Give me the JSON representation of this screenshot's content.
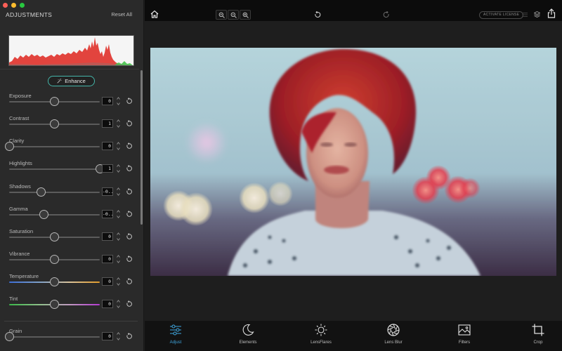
{
  "panel": {
    "title": "ADJUSTMENTS",
    "reset_all": "Reset All",
    "enhance_label": "Enhance"
  },
  "sliders": [
    {
      "id": "exposure",
      "label": "Exposure",
      "value": "0",
      "level": 0.5,
      "track": "plain"
    },
    {
      "id": "contrast",
      "label": "Contrast",
      "value": "1",
      "level": 0.5,
      "track": "plain"
    },
    {
      "id": "clarity",
      "label": "Clarity",
      "value": "0",
      "level": 0.0,
      "track": "plain"
    },
    {
      "id": "highlights",
      "label": "Highlights",
      "value": "1",
      "level": 1.0,
      "track": "plain"
    },
    {
      "id": "shadows",
      "label": "Shadows",
      "value": "-0...",
      "level": 0.35,
      "track": "plain"
    },
    {
      "id": "gamma",
      "label": "Gamma",
      "value": "-0...",
      "level": 0.38,
      "track": "plain"
    },
    {
      "id": "saturation",
      "label": "Saturation",
      "value": "0",
      "level": 0.5,
      "track": "plain"
    },
    {
      "id": "vibrance",
      "label": "Vibrance",
      "value": "0",
      "level": 0.5,
      "track": "plain"
    },
    {
      "id": "temperature",
      "label": "Temperature",
      "value": "0",
      "level": 0.5,
      "track": "temperature"
    },
    {
      "id": "tint",
      "label": "Tint",
      "value": "0",
      "level": 0.5,
      "track": "tint"
    },
    {
      "id": "grain",
      "label": "Grain",
      "value": "0",
      "level": 0.0,
      "track": "plain"
    }
  ],
  "topbar": {
    "activate_license": "ACTIVATE LICENSE"
  },
  "tools": [
    {
      "id": "adjust",
      "label": "Adjust",
      "icon": "sliders-icon",
      "active": true
    },
    {
      "id": "elements",
      "label": "Elements",
      "icon": "moon-icon",
      "active": false
    },
    {
      "id": "lensflares",
      "label": "LensFlares",
      "icon": "sun-icon",
      "active": false
    },
    {
      "id": "lensblur",
      "label": "Lens Blur",
      "icon": "aperture-icon",
      "active": false
    },
    {
      "id": "filters",
      "label": "Filters",
      "icon": "landscape-icon",
      "active": false
    },
    {
      "id": "crop",
      "label": "Crop",
      "icon": "crop-icon",
      "active": false
    }
  ],
  "colors": {
    "accent": "#3fa7e0",
    "enhance_border": "#45b5a9",
    "histogram_red": "#e0312a",
    "histogram_green": "#45c34a"
  }
}
